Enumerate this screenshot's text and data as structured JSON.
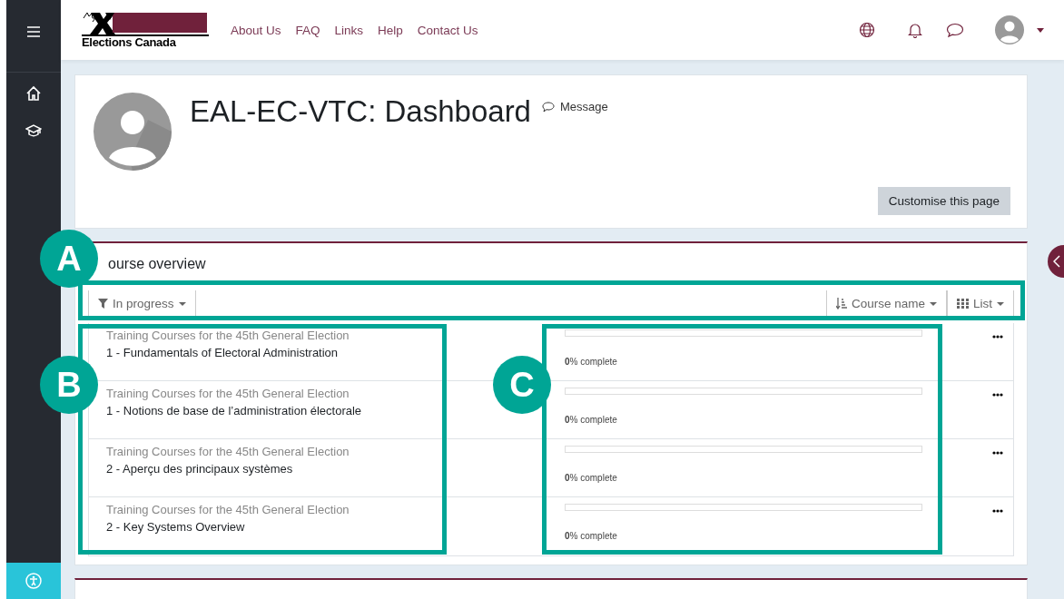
{
  "header": {
    "logo_text": "Elections Canada",
    "nav_links": [
      "About Us",
      "FAQ",
      "Links",
      "Help",
      "Contact Us"
    ]
  },
  "profile": {
    "title": "EAL-EC-VTC: Dashboard",
    "message_link": "Message",
    "customise_button": "Customise this page"
  },
  "course_overview": {
    "title": "ourse overview",
    "filter": "In progress",
    "sort": "Course name",
    "view": "List",
    "courses": [
      {
        "category": "Training Courses for the 45th General Election",
        "name": "1 - Fundamentals of Electoral Administration",
        "level": 0,
        "progress_text": "**0**% complete"
      },
      {
        "category": "Training Courses for the 45th General Election",
        "name": "1 - Notions de base de l’administration électorale",
        "level": 0,
        "progress_text": "**0**% complete"
      },
      {
        "category": "Training Courses for the 45th General Election",
        "name": "2 - Aperçu des principaux systèmes",
        "level": 0,
        "progress_text": "**0**% complete"
      },
      {
        "category": "Training Courses for the 45th General Election",
        "name": "2 - Key Systems Overview",
        "level": 0,
        "progress_text": "**0**% complete"
      }
    ]
  },
  "callouts": [
    {
      "label": "A"
    },
    {
      "label": "B"
    },
    {
      "label": "C"
    }
  ]
}
